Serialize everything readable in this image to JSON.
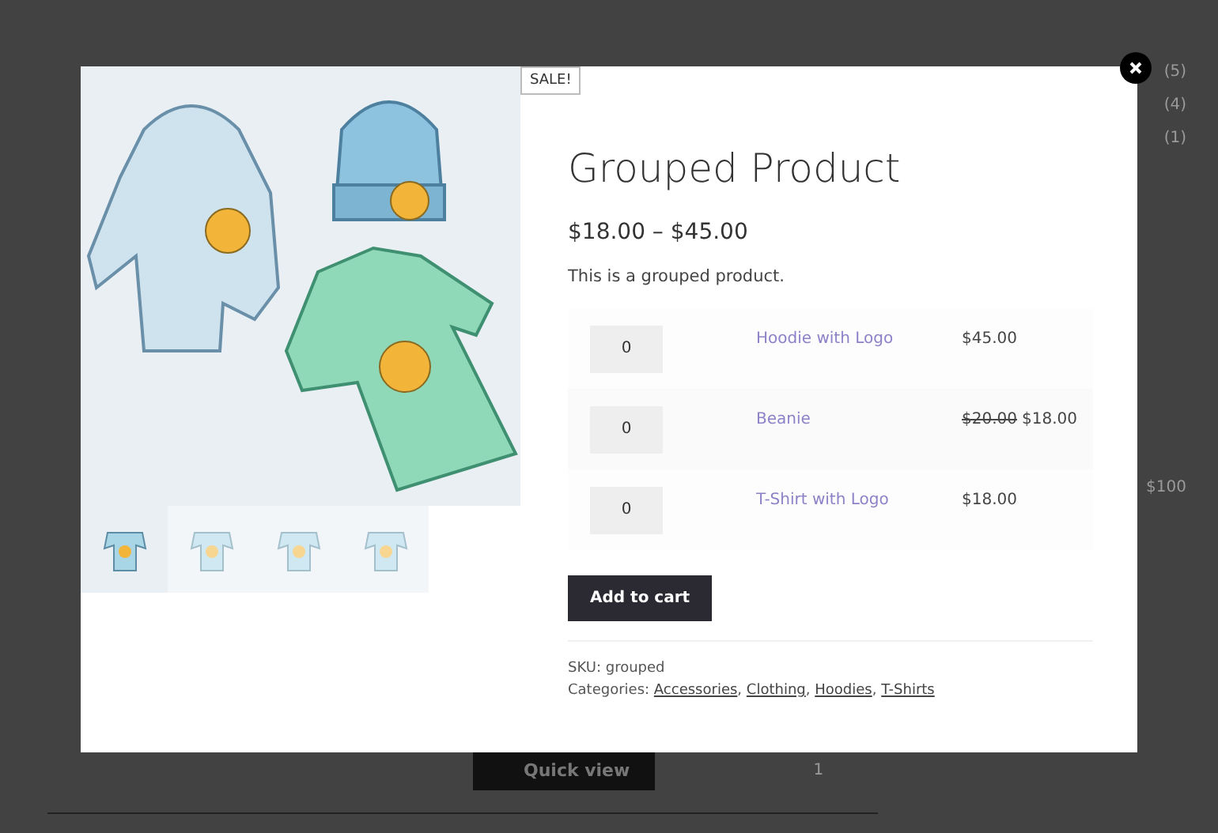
{
  "background": {
    "sidebar_counts": [
      "(5)",
      "(4)",
      "(1)"
    ],
    "price_filter_max": "$100",
    "quick_view": "Quick view",
    "quantity": "1"
  },
  "modal": {
    "badge": "SALE!",
    "thumbnails": [
      {
        "selected": true
      },
      {
        "selected": false
      },
      {
        "selected": false
      },
      {
        "selected": false
      }
    ],
    "title": "Grouped Product",
    "price_range": "$18.00 – $45.00",
    "description": "This is a grouped product.",
    "items": [
      {
        "quantity": "0",
        "name": "Hoodie with Logo",
        "price": "$45.00"
      },
      {
        "quantity": "0",
        "name": "Beanie",
        "old_price": "$20.00",
        "price": "$18.00"
      },
      {
        "quantity": "0",
        "name": "T-Shirt with Logo",
        "price": "$18.00"
      }
    ],
    "add_to_cart": "Add to cart",
    "sku_label": "SKU:",
    "sku": "grouped",
    "categories_label": "Categories:",
    "category_separator": ",",
    "categories": [
      "Accessories",
      "Clothing",
      "Hoodies",
      "T-Shirts"
    ]
  }
}
